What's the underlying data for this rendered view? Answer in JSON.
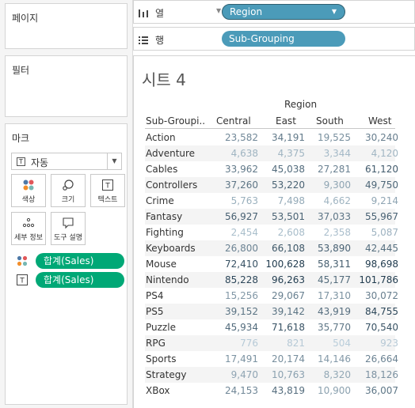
{
  "left": {
    "pages_title": "페이지",
    "filters_title": "필터",
    "marks_title": "마크",
    "mark_type": "자동",
    "buttons": {
      "color": "색상",
      "size": "크기",
      "text": "텍스트",
      "detail": "세부 정보",
      "tooltip": "도구 설명"
    },
    "pills": [
      "합계(Sales)",
      "합계(Sales)"
    ]
  },
  "shelves": {
    "columns_label": "열",
    "columns_pill": "Region",
    "rows_label": "행",
    "rows_pill": "Sub-Grouping"
  },
  "sheet": {
    "title": "시트 4",
    "column_group": "Region",
    "row_header": "Sub-Groupi..",
    "columns": [
      "Central",
      "East",
      "South",
      "West"
    ],
    "rows": [
      {
        "name": "Action",
        "values": [
          "23,582",
          "34,191",
          "19,525",
          "30,240"
        ]
      },
      {
        "name": "Adventure",
        "values": [
          "4,638",
          "4,375",
          "3,344",
          "4,120"
        ]
      },
      {
        "name": "Cables",
        "values": [
          "33,962",
          "45,038",
          "27,281",
          "61,120"
        ]
      },
      {
        "name": "Controllers",
        "values": [
          "37,260",
          "53,220",
          "9,300",
          "49,750"
        ]
      },
      {
        "name": "Crime",
        "values": [
          "5,763",
          "7,498",
          "4,662",
          "9,214"
        ]
      },
      {
        "name": "Fantasy",
        "values": [
          "56,927",
          "53,501",
          "37,033",
          "55,967"
        ]
      },
      {
        "name": "Fighting",
        "values": [
          "2,454",
          "2,608",
          "2,358",
          "5,087"
        ]
      },
      {
        "name": "Keyboards",
        "values": [
          "26,800",
          "66,108",
          "53,890",
          "42,445"
        ]
      },
      {
        "name": "Mouse",
        "values": [
          "72,410",
          "100,628",
          "58,311",
          "98,698"
        ]
      },
      {
        "name": "Nintendo",
        "values": [
          "85,228",
          "96,263",
          "45,177",
          "101,786"
        ]
      },
      {
        "name": "PS4",
        "values": [
          "15,256",
          "29,067",
          "17,310",
          "30,072"
        ]
      },
      {
        "name": "PS5",
        "values": [
          "39,152",
          "39,142",
          "43,919",
          "84,755"
        ]
      },
      {
        "name": "Puzzle",
        "values": [
          "45,934",
          "71,618",
          "35,770",
          "70,540"
        ]
      },
      {
        "name": "RPG",
        "values": [
          "776",
          "821",
          "504",
          "923"
        ]
      },
      {
        "name": "Sports",
        "values": [
          "17,491",
          "20,174",
          "14,146",
          "26,664"
        ]
      },
      {
        "name": "Strategy",
        "values": [
          "9,470",
          "10,763",
          "8,320",
          "18,126"
        ]
      },
      {
        "name": "XBox",
        "values": [
          "24,153",
          "43,819",
          "10,900",
          "36,007"
        ]
      }
    ],
    "color_scale": {
      "low": "#c9dce8",
      "high": "#1f3a4d",
      "max": 101786
    }
  }
}
